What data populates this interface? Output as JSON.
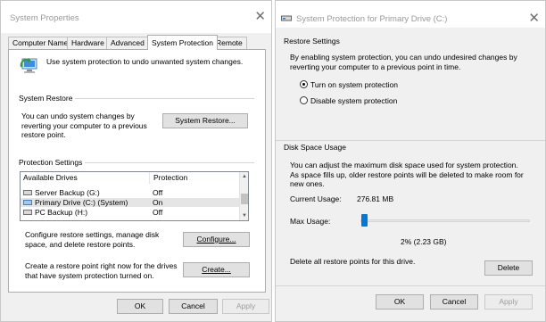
{
  "left_window": {
    "title": "System Properties",
    "tabs": [
      "Computer Name",
      "Hardware",
      "Advanced",
      "System Protection",
      "Remote"
    ],
    "active_tab": "System Protection",
    "intro_text": "Use system protection to undo unwanted system changes.",
    "restore_group_title": "System Restore",
    "restore_text": "You can undo system changes by reverting your computer to a previous restore point.",
    "restore_button": "System Restore...",
    "protection_group_title": "Protection Settings",
    "columns": {
      "drives": "Available Drives",
      "protection": "Protection"
    },
    "drives": [
      {
        "name": "Server Backup (G:)",
        "protection": "Off",
        "icon": "drive-icon",
        "selected": false
      },
      {
        "name": "Primary Drive (C:) (System)",
        "protection": "On",
        "icon": "system-drive-icon",
        "selected": true
      },
      {
        "name": "PC Backup (H:)",
        "protection": "Off",
        "icon": "drive-icon",
        "selected": false
      }
    ],
    "configure_text": "Configure restore settings, manage disk space, and delete restore points.",
    "configure_button": "Configure...",
    "create_text": "Create a restore point right now for the drives that have system protection turned on.",
    "create_button": "Create...",
    "buttons": {
      "ok": "OK",
      "cancel": "Cancel",
      "apply": "Apply"
    }
  },
  "right_window": {
    "title": "System Protection for Primary Drive (C:)",
    "restore_settings_title": "Restore Settings",
    "restore_settings_text": "By enabling system protection, you can undo undesired changes by reverting your computer to a previous point in time.",
    "radio_on": "Turn on system protection",
    "radio_off": "Disable system protection",
    "radio_selected": "on",
    "disk_usage_title": "Disk Space Usage",
    "disk_usage_text": "You can adjust the maximum disk space used for system protection. As space fills up, older restore points will be deleted to make room for new ones.",
    "current_usage_label": "Current Usage:",
    "current_usage_value": "276.81 MB",
    "max_usage_label": "Max Usage:",
    "max_usage_percent": 2,
    "max_usage_value": "2% (2.23 GB)",
    "delete_text": "Delete all restore points for this drive.",
    "delete_button": "Delete",
    "buttons": {
      "ok": "OK",
      "cancel": "Cancel",
      "apply": "Apply"
    }
  },
  "colors": {
    "accent": "#0078d7",
    "selected_row": "#e5e5e5",
    "window_bg": "#f0f0f0"
  }
}
